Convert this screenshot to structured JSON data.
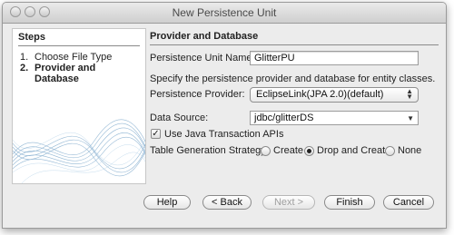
{
  "window": {
    "title": "New Persistence Unit"
  },
  "steps": {
    "heading": "Steps",
    "items": [
      {
        "num": "1.",
        "label": "Choose File Type",
        "active": false
      },
      {
        "num": "2.",
        "label": "Provider and Database",
        "active": true
      }
    ]
  },
  "main": {
    "heading": "Provider and Database",
    "unit_name_label": "Persistence Unit Name:",
    "unit_name_value": "GlitterPU",
    "description": "Specify the persistence provider and database for entity classes.",
    "provider_label": "Persistence Provider:",
    "provider_value": "EclipseLink(JPA 2.0)(default)",
    "datasource_label": "Data Source:",
    "datasource_value": "jdbc/glitterDS",
    "use_jta_label": "Use Java Transaction APIs",
    "use_jta_checked": true,
    "strategy_label": "Table Generation Strategy:",
    "strategy_options": [
      "Create",
      "Drop and Create",
      "None"
    ],
    "strategy_selected": "Drop and Create"
  },
  "buttons": {
    "help": "Help",
    "back": "< Back",
    "next": "Next >",
    "finish": "Finish",
    "cancel": "Cancel"
  },
  "icons": {
    "check": "✓",
    "select_arrows": "▲▼",
    "combo_arrow": "▼"
  }
}
